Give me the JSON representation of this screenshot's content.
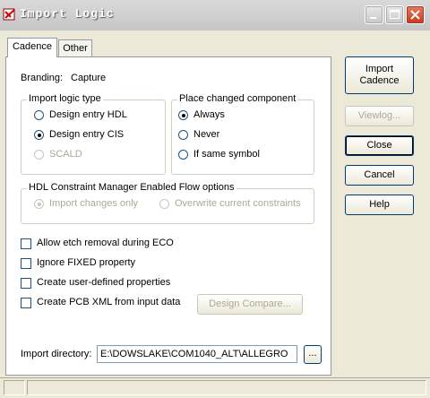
{
  "window": {
    "title": "Import Logic",
    "icon": "import-logic-app-icon",
    "controls": {
      "minimize_icon": "minimize-icon",
      "maximize_icon": "maximize-icon",
      "close_icon": "close-icon"
    }
  },
  "tabs": [
    {
      "label": "Cadence",
      "selected": true
    },
    {
      "label": "Other",
      "selected": false
    }
  ],
  "branding": {
    "label": "Branding:",
    "value": "Capture"
  },
  "import_logic_type": {
    "legend": "Import logic type",
    "options": [
      {
        "label": "Design entry HDL",
        "selected": false,
        "enabled": true
      },
      {
        "label": "Design entry CIS",
        "selected": true,
        "enabled": true
      },
      {
        "label": "SCALD",
        "selected": false,
        "enabled": false
      }
    ]
  },
  "place_changed_component": {
    "legend": "Place changed component",
    "options": [
      {
        "label": "Always",
        "selected": true
      },
      {
        "label": "Never",
        "selected": false
      },
      {
        "label": "If same symbol",
        "selected": false
      }
    ]
  },
  "hdl_constraint": {
    "legend": "HDL Constraint Manager Enabled Flow options",
    "options": [
      {
        "label": "Import changes only",
        "selected": true,
        "enabled": false
      },
      {
        "label": "Overwrite current constraints",
        "selected": false,
        "enabled": false
      }
    ]
  },
  "checkboxes": [
    {
      "label": "Allow etch removal during ECO",
      "checked": false
    },
    {
      "label": "Ignore FIXED property",
      "checked": false
    },
    {
      "label": "Create user-defined properties",
      "checked": false
    },
    {
      "label": "Create PCB XML from input data",
      "checked": false
    }
  ],
  "design_compare_label": "Design Compare...",
  "import_directory": {
    "label": "Import directory:",
    "value": "E:\\DOWSLAKE\\COM1040_ALT\\ALLEGRO",
    "browse_label": "..."
  },
  "side_buttons": {
    "import_line1": "Import",
    "import_line2": "Cadence",
    "viewlog": "Viewlog...",
    "close": "Close",
    "cancel": "Cancel",
    "help": "Help"
  }
}
